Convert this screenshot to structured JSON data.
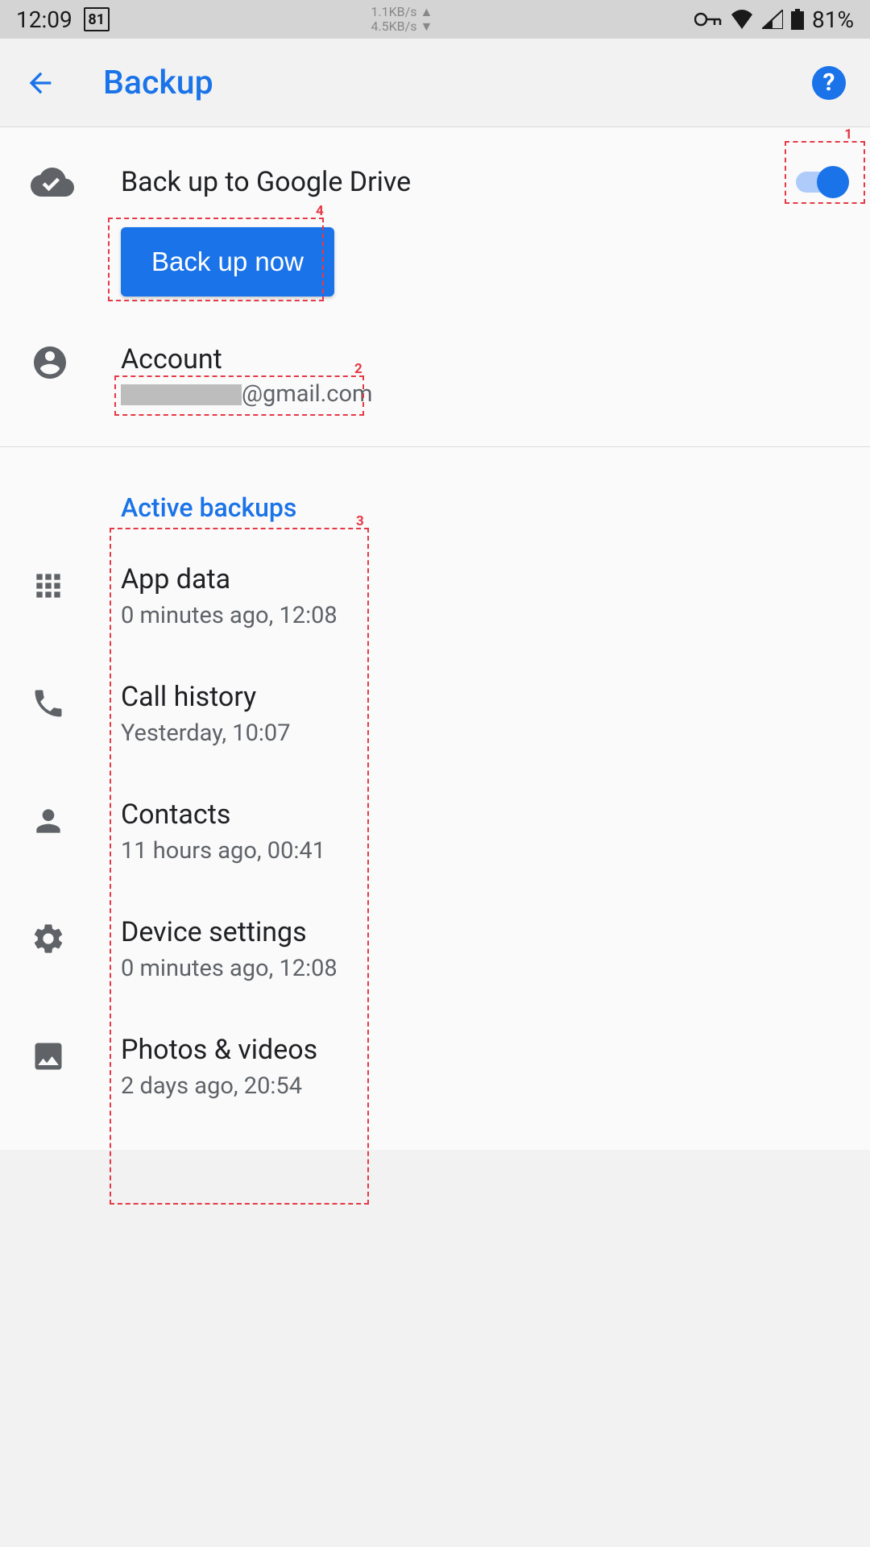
{
  "status": {
    "time": "12:09",
    "cal": "81",
    "net_up": "1.1KB/s ▲",
    "net_down": "4.5KB/s ▼",
    "battery": "81%"
  },
  "header": {
    "title": "Backup"
  },
  "main": {
    "backup_drive_label": "Back up to Google Drive",
    "backup_now_button": "Back up now",
    "account_label": "Account",
    "account_email": "@gmail.com"
  },
  "section_header": "Active backups",
  "backups": [
    {
      "title": "App data",
      "time": "0 minutes ago, 12:08"
    },
    {
      "title": "Call history",
      "time": "Yesterday, 10:07"
    },
    {
      "title": "Contacts",
      "time": "11 hours ago, 00:41"
    },
    {
      "title": "Device settings",
      "time": "0 minutes ago, 12:08"
    },
    {
      "title": "Photos & videos",
      "time": "2 days ago, 20:54"
    }
  ],
  "annotations": {
    "1": "1",
    "2": "2",
    "3": "3",
    "4": "4"
  }
}
